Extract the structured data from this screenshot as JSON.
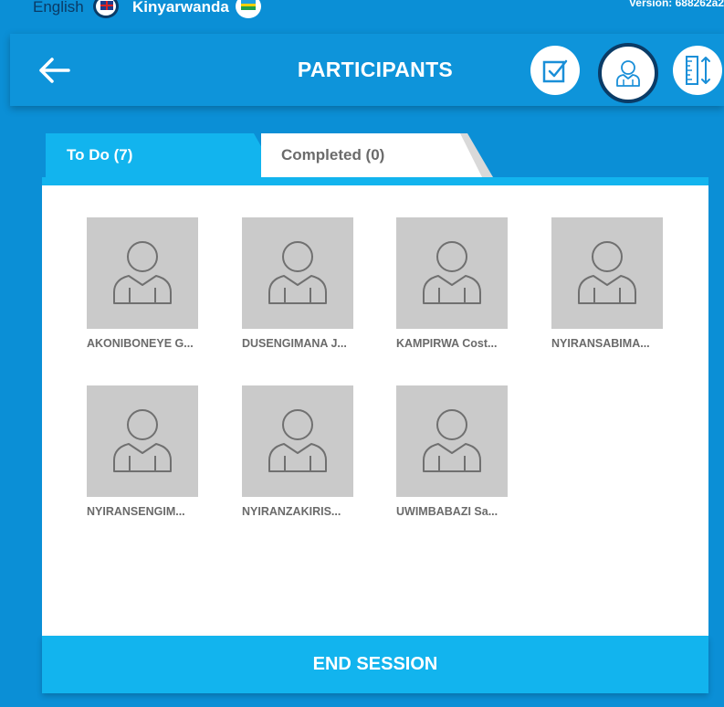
{
  "top_bar": {
    "lang_en": "English",
    "lang_rw": "Kinyarwanda",
    "version": "Version: 688262a2"
  },
  "header": {
    "title": "PARTICIPANTS",
    "icons": [
      "back-arrow-icon",
      "checkbox-icon",
      "user-icon",
      "measure-icon"
    ]
  },
  "tabs": [
    {
      "label": "To Do (7)",
      "active": true
    },
    {
      "label": "Completed (0)",
      "active": false
    }
  ],
  "participants": [
    {
      "name": "AKONIBONEYE G..."
    },
    {
      "name": "DUSENGIMANA J..."
    },
    {
      "name": "KAMPIRWA Cost..."
    },
    {
      "name": "NYIRANSABIMA..."
    },
    {
      "name": "NYIRANSENGIM..."
    },
    {
      "name": "NYIRANZAKIRIS..."
    },
    {
      "name": "UWIMBABAZI Sa..."
    }
  ],
  "end_session": "END SESSION",
  "colors": {
    "background": "#0b8fd6",
    "accent": "#12b4ee",
    "dark_ring": "#0a3b66",
    "avatar_bg": "#cacaca"
  }
}
